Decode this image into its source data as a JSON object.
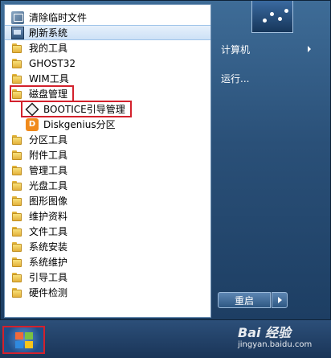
{
  "programs": [
    {
      "label": "清除临时文件",
      "icon": "cleanup-icon"
    },
    {
      "label": "刷新系统",
      "icon": "refresh-system-icon",
      "selected": true
    },
    {
      "label": "我的工具",
      "icon": "folder-icon"
    },
    {
      "label": "GHOST32",
      "icon": "folder-icon"
    },
    {
      "label": "WIM工具",
      "icon": "folder-icon"
    },
    {
      "label": "磁盘管理",
      "icon": "folder-icon"
    },
    {
      "label": "BOOTICE引导管理",
      "icon": "bootice-icon"
    },
    {
      "label": "Diskgenius分区",
      "icon": "diskgenius-icon"
    },
    {
      "label": "分区工具",
      "icon": "folder-icon"
    },
    {
      "label": "附件工具",
      "icon": "folder-icon"
    },
    {
      "label": "管理工具",
      "icon": "folder-icon"
    },
    {
      "label": "光盘工具",
      "icon": "folder-icon"
    },
    {
      "label": "图形图像",
      "icon": "folder-icon"
    },
    {
      "label": "维护资料",
      "icon": "folder-icon"
    },
    {
      "label": "文件工具",
      "icon": "folder-icon"
    },
    {
      "label": "系统安装",
      "icon": "folder-icon"
    },
    {
      "label": "系统维护",
      "icon": "folder-icon"
    },
    {
      "label": "引导工具",
      "icon": "folder-icon"
    },
    {
      "label": "硬件检测",
      "icon": "folder-icon"
    }
  ],
  "right_pane": {
    "computer": "计算机",
    "run": "运行..."
  },
  "shutdown": {
    "label": "重启"
  },
  "watermark": {
    "brand": "Bai 经验",
    "url": "jingyan.baidu.com"
  },
  "highlight_color": "#d3212c"
}
